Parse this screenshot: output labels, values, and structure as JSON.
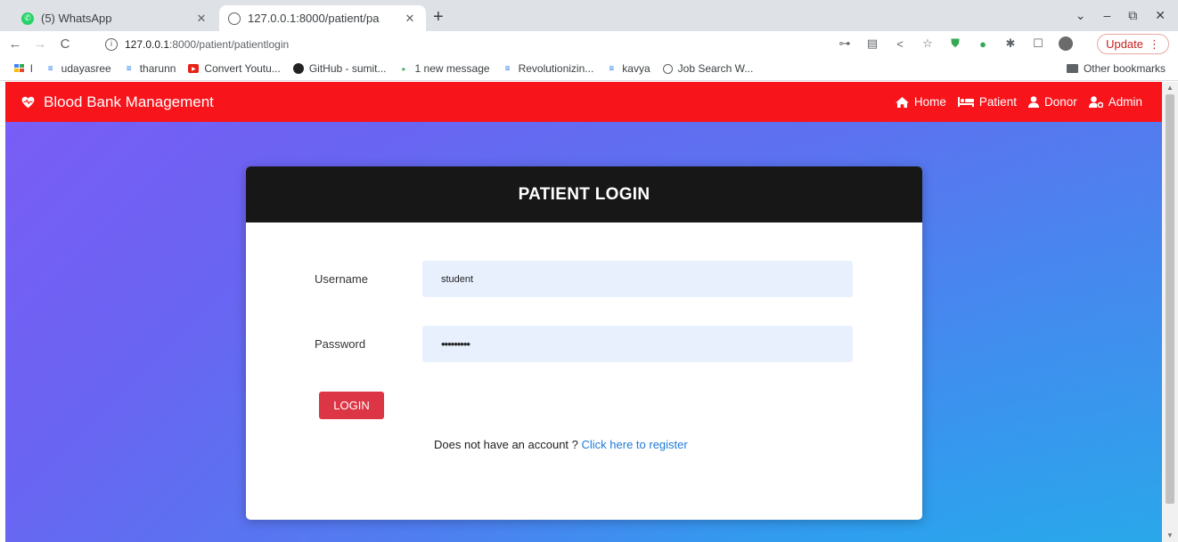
{
  "browser": {
    "tabs": [
      {
        "title": "(5) WhatsApp",
        "active": false
      },
      {
        "title": "127.0.0.1:8000/patient/pa",
        "active": true
      }
    ],
    "new_tab": "+",
    "address": {
      "host": "127.0.0.1",
      "path": ":8000/patient/patientlogin"
    },
    "update_label": "Update",
    "bookmarks": [
      {
        "label": "l",
        "icon": "apps-icon"
      },
      {
        "label": "udayasree",
        "icon": "list-icon"
      },
      {
        "label": "tharunn",
        "icon": "list-icon"
      },
      {
        "label": "Convert Youtu...",
        "icon": "youtube-icon"
      },
      {
        "label": "GitHub - sumit...",
        "icon": "github-icon"
      },
      {
        "label": "1 new message",
        "icon": "play-icon"
      },
      {
        "label": "Revolutionizin...",
        "icon": "list-icon"
      },
      {
        "label": "kavya",
        "icon": "list-icon"
      },
      {
        "label": "Job Search W...",
        "icon": "globe-icon"
      }
    ],
    "other_bookmarks": "Other bookmarks"
  },
  "navbar": {
    "brand": "Blood Bank Management",
    "links": [
      {
        "label": "Home",
        "icon": "home-icon"
      },
      {
        "label": "Patient",
        "icon": "bed-icon"
      },
      {
        "label": "Donor",
        "icon": "user-icon"
      },
      {
        "label": "Admin",
        "icon": "user-cog-icon"
      }
    ],
    "color": "#f8141b"
  },
  "login": {
    "title": "PATIENT LOGIN",
    "username_label": "Username",
    "username_value": "student",
    "password_label": "Password",
    "password_value": "•••••••••",
    "button": "LOGIN",
    "register_prompt": "Does not have an account ?",
    "register_link": "Click here to register"
  },
  "colors": {
    "login_button": "#dc3545",
    "link": "#1f7ad9",
    "card_header": "#171717"
  }
}
